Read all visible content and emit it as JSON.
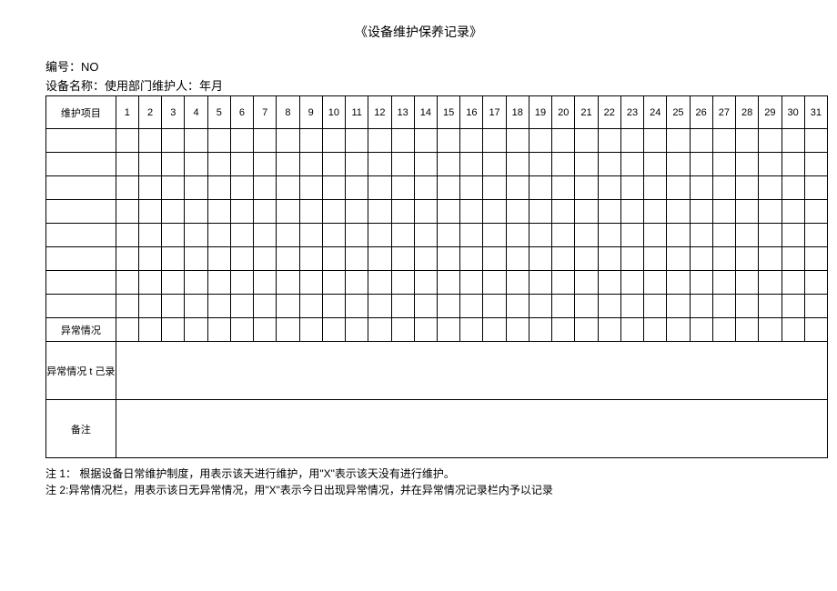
{
  "title": "《设备维护保养记录》",
  "meta": {
    "line1_prefix": "编号：",
    "line1_no": "NO",
    "line2": "设备名称：使用部门维护人：年月"
  },
  "table": {
    "header_label": "维护项目",
    "days": [
      "1",
      "2",
      "3",
      "4",
      "5",
      "6",
      "7",
      "8",
      "9",
      "10",
      "11",
      "12",
      "13",
      "14",
      "15",
      "16",
      "17",
      "18",
      "19",
      "20",
      "21",
      "22",
      "23",
      "24",
      "25",
      "26",
      "27",
      "28",
      "29",
      "30",
      "31"
    ],
    "abnormal_label": "异常情况",
    "abnormal_record_label": "异常情况 t 己录",
    "remark_label": "备注"
  },
  "notes": {
    "n1": "注 1： 根据设备日常维护制度，用表示该天进行维护，用\"X\"表示该天没有进行维护。",
    "n2": "注 2:异常情况栏，用表示该日无异常情况，用\"X\"表示今日出现异常情况，并在异常情况记录栏内予以记录"
  }
}
